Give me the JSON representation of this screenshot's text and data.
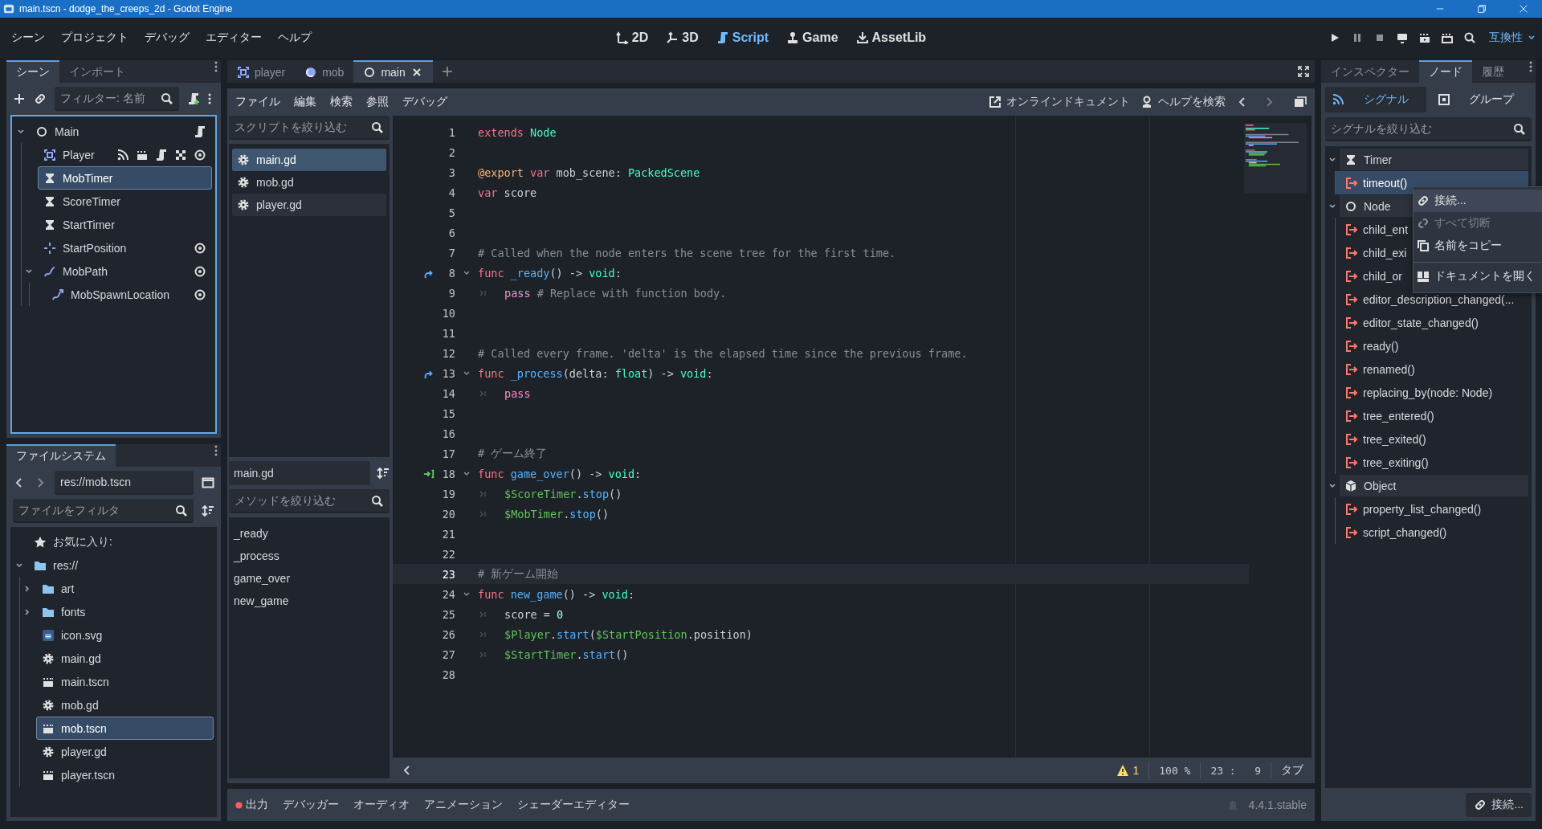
{
  "window": {
    "title": "main.tscn - dodge_the_creeps_2d - Godot Engine"
  },
  "menu": [
    "シーン",
    "プロジェクト",
    "デバッグ",
    "エディター",
    "ヘルプ"
  ],
  "workspaces": [
    {
      "label": "2D",
      "kind": "planar",
      "selected": false
    },
    {
      "label": "3D",
      "kind": "spatial",
      "selected": false
    },
    {
      "label": "Script",
      "kind": "script",
      "selected": true
    },
    {
      "label": "Game",
      "kind": "game",
      "selected": false
    },
    {
      "label": "AssetLib",
      "kind": "assetlib",
      "selected": false
    }
  ],
  "renderer": "互換性",
  "scene_dock": {
    "tabs": [
      {
        "label": "シーン",
        "selected": true
      },
      {
        "label": "インポート",
        "selected": false
      }
    ],
    "filter": {
      "placeholder": "フィルター: 名前"
    },
    "tree": [
      {
        "name": "Main",
        "kind": "node",
        "selected": false,
        "expanded": true,
        "badges": [
          {
            "kind": "script"
          }
        ],
        "children": [
          {
            "name": "Player",
            "kind": "node2d",
            "selected": false,
            "badges": [
              {
                "kind": "signal"
              },
              {
                "kind": "instance"
              },
              {
                "kind": "script"
              },
              {
                "kind": "editable"
              },
              {
                "kind": "eye"
              }
            ]
          },
          {
            "name": "MobTimer",
            "kind": "timer",
            "selected": true
          },
          {
            "name": "ScoreTimer",
            "kind": "timer",
            "selected": false
          },
          {
            "name": "StartTimer",
            "kind": "timer",
            "selected": false
          },
          {
            "name": "StartPosition",
            "kind": "marker",
            "selected": false,
            "badges": [
              {
                "kind": "eye"
              }
            ]
          },
          {
            "name": "MobPath",
            "kind": "path",
            "selected": false,
            "expanded": true,
            "badges": [
              {
                "kind": "eye"
              }
            ],
            "children": [
              {
                "name": "MobSpawnLocation",
                "kind": "pathfollow",
                "selected": false,
                "badges": [
                  {
                    "kind": "eye"
                  }
                ]
              }
            ]
          }
        ]
      }
    ]
  },
  "filesystem": {
    "tab": "ファイルシステム",
    "path": "res://mob.tscn",
    "filter": {
      "placeholder": "ファイルをフィルタ"
    },
    "favorites": "お気に入り:",
    "tree": [
      {
        "name": "res://",
        "kind": "folder",
        "selected": false,
        "expanded": true,
        "children": [
          {
            "name": "art",
            "kind": "folder",
            "selected": false,
            "expanded": false
          },
          {
            "name": "fonts",
            "kind": "folder",
            "selected": false,
            "expanded": false
          },
          {
            "name": "icon.svg",
            "kind": "image",
            "selected": false
          },
          {
            "name": "main.gd",
            "kind": "script",
            "selected": false
          },
          {
            "name": "main.tscn",
            "kind": "scene",
            "selected": false
          },
          {
            "name": "mob.gd",
            "kind": "script",
            "selected": false
          },
          {
            "name": "mob.tscn",
            "kind": "scene",
            "selected": true
          },
          {
            "name": "player.gd",
            "kind": "script",
            "selected": false
          },
          {
            "name": "player.tscn",
            "kind": "scene",
            "selected": false
          }
        ]
      }
    ]
  },
  "editor_tabs": [
    {
      "label": "player",
      "kind": "node2d",
      "selected": false
    },
    {
      "label": "mob",
      "kind": "rigid",
      "selected": false
    },
    {
      "label": "main",
      "kind": "node",
      "selected": true
    }
  ],
  "script_menu": [
    "ファイル",
    "編集",
    "検索",
    "参照",
    "デバッグ"
  ],
  "help_links": [
    {
      "label": "オンラインドキュメント",
      "kind": "external"
    },
    {
      "label": "ヘルプを検索",
      "kind": "help"
    }
  ],
  "scripts": {
    "filter": {
      "placeholder": "スクリプトを絞り込む"
    },
    "items": [
      {
        "name": "main.gd",
        "selected": true,
        "hovered": false
      },
      {
        "name": "mob.gd",
        "selected": false,
        "hovered": false
      },
      {
        "name": "player.gd",
        "selected": false,
        "hovered": true
      }
    ],
    "current": "main.gd",
    "method_filter": {
      "placeholder": "メソッドを絞り込む"
    },
    "methods": [
      "_ready",
      "_process",
      "game_over",
      "new_game"
    ]
  },
  "code": {
    "lines": [
      {
        "n": "1",
        "current": false,
        "foldable": false,
        "indented": false,
        "tokens": [
          {
            "kind": "keyword",
            "t": "extends "
          },
          {
            "kind": "type",
            "t": "Node"
          }
        ]
      },
      {
        "n": "2",
        "current": false,
        "foldable": false,
        "indented": false
      },
      {
        "n": "3",
        "current": false,
        "foldable": false,
        "indented": false,
        "tokens": [
          {
            "kind": "annotation",
            "t": "@export "
          },
          {
            "kind": "keyword",
            "t": "var"
          },
          {
            "kind": "plain",
            "t": " mob_scene: "
          },
          {
            "kind": "type",
            "t": "PackedScene"
          }
        ]
      },
      {
        "n": "4",
        "current": false,
        "foldable": false,
        "indented": false,
        "tokens": [
          {
            "kind": "keyword",
            "t": "var"
          },
          {
            "kind": "plain",
            "t": " score"
          }
        ]
      },
      {
        "n": "5",
        "current": false,
        "foldable": false,
        "indented": false
      },
      {
        "n": "6",
        "current": false,
        "foldable": false,
        "indented": false
      },
      {
        "n": "7",
        "current": false,
        "foldable": false,
        "indented": false,
        "tokens": [
          {
            "kind": "comment",
            "t": "# Called when the node enters the scene tree for the first time."
          }
        ]
      },
      {
        "n": "8",
        "current": false,
        "foldable": true,
        "indented": false,
        "gutter": {
          "kind": "override"
        },
        "tokens": [
          {
            "kind": "keyword",
            "t": "func "
          },
          {
            "kind": "function",
            "t": "_ready"
          },
          {
            "kind": "plain",
            "t": "() -> "
          },
          {
            "kind": "type",
            "t": "void"
          },
          {
            "kind": "plain",
            "t": ":"
          }
        ]
      },
      {
        "n": "9",
        "current": false,
        "foldable": false,
        "indented": true,
        "tokens": [
          {
            "kind": "control",
            "t": "pass"
          },
          {
            "kind": "comment",
            "t": " # Replace with function body."
          }
        ]
      },
      {
        "n": "10",
        "current": false,
        "foldable": false,
        "indented": false
      },
      {
        "n": "11",
        "current": false,
        "foldable": false,
        "indented": false
      },
      {
        "n": "12",
        "current": false,
        "foldable": false,
        "indented": false,
        "tokens": [
          {
            "kind": "comment",
            "t": "# Called every frame. 'delta' is the elapsed time since the previous frame."
          }
        ]
      },
      {
        "n": "13",
        "current": false,
        "foldable": true,
        "indented": false,
        "gutter": {
          "kind": "override"
        },
        "tokens": [
          {
            "kind": "keyword",
            "t": "func "
          },
          {
            "kind": "function",
            "t": "_process"
          },
          {
            "kind": "plain",
            "t": "(delta: "
          },
          {
            "kind": "type",
            "t": "float"
          },
          {
            "kind": "plain",
            "t": ") -> "
          },
          {
            "kind": "type",
            "t": "void"
          },
          {
            "kind": "plain",
            "t": ":"
          }
        ]
      },
      {
        "n": "14",
        "current": false,
        "foldable": false,
        "indented": true,
        "tokens": [
          {
            "kind": "control",
            "t": "pass"
          }
        ]
      },
      {
        "n": "15",
        "current": false,
        "foldable": false,
        "indented": false
      },
      {
        "n": "16",
        "current": false,
        "foldable": false,
        "indented": false
      },
      {
        "n": "17",
        "current": false,
        "foldable": false,
        "indented": false,
        "tokens": [
          {
            "kind": "comment",
            "t": "# ゲーム終了"
          }
        ]
      },
      {
        "n": "18",
        "current": false,
        "foldable": true,
        "indented": false,
        "gutter": {
          "kind": "connected"
        },
        "tokens": [
          {
            "kind": "keyword",
            "t": "func "
          },
          {
            "kind": "function",
            "t": "game_over"
          },
          {
            "kind": "plain",
            "t": "() -> "
          },
          {
            "kind": "type",
            "t": "void"
          },
          {
            "kind": "plain",
            "t": ":"
          }
        ]
      },
      {
        "n": "19",
        "current": false,
        "foldable": false,
        "indented": true,
        "tokens": [
          {
            "kind": "nodepath",
            "t": "$ScoreTimer"
          },
          {
            "kind": "plain",
            "t": "."
          },
          {
            "kind": "function",
            "t": "stop"
          },
          {
            "kind": "plain",
            "t": "()"
          }
        ]
      },
      {
        "n": "20",
        "current": false,
        "foldable": false,
        "indented": true,
        "tokens": [
          {
            "kind": "nodepath",
            "t": "$MobTimer"
          },
          {
            "kind": "plain",
            "t": "."
          },
          {
            "kind": "function",
            "t": "stop"
          },
          {
            "kind": "plain",
            "t": "()"
          }
        ]
      },
      {
        "n": "21",
        "current": false,
        "foldable": false,
        "indented": false
      },
      {
        "n": "22",
        "current": false,
        "foldable": false,
        "indented": false
      },
      {
        "n": "23",
        "current": true,
        "foldable": false,
        "indented": false,
        "tokens": [
          {
            "kind": "comment",
            "t": "# 新ゲーム開始"
          }
        ]
      },
      {
        "n": "24",
        "current": false,
        "foldable": true,
        "indented": false,
        "tokens": [
          {
            "kind": "keyword",
            "t": "func "
          },
          {
            "kind": "function",
            "t": "new_game"
          },
          {
            "kind": "plain",
            "t": "() -> "
          },
          {
            "kind": "type",
            "t": "void"
          },
          {
            "kind": "plain",
            "t": ":"
          }
        ]
      },
      {
        "n": "25",
        "current": false,
        "foldable": false,
        "indented": true,
        "tokens": [
          {
            "kind": "plain",
            "t": "score = "
          },
          {
            "kind": "number",
            "t": "0"
          }
        ]
      },
      {
        "n": "26",
        "current": false,
        "foldable": false,
        "indented": true,
        "tokens": [
          {
            "kind": "nodepath",
            "t": "$Player"
          },
          {
            "kind": "plain",
            "t": "."
          },
          {
            "kind": "function",
            "t": "start"
          },
          {
            "kind": "plain",
            "t": "("
          },
          {
            "kind": "nodepath",
            "t": "$StartPosition"
          },
          {
            "kind": "plain",
            "t": ".position)"
          }
        ]
      },
      {
        "n": "27",
        "current": false,
        "foldable": false,
        "indented": true,
        "tokens": [
          {
            "kind": "nodepath",
            "t": "$StartTimer"
          },
          {
            "kind": "plain",
            "t": "."
          },
          {
            "kind": "function",
            "t": "start"
          },
          {
            "kind": "plain",
            "t": "()"
          }
        ]
      },
      {
        "n": "28",
        "current": false,
        "foldable": false,
        "indented": false
      }
    ]
  },
  "status": {
    "warnings": "1",
    "zoom": "100 %",
    "cursor": "23 :   9",
    "indent": "タブ"
  },
  "bottom_tabs": [
    {
      "label": "出力",
      "alert": true
    },
    {
      "label": "デバッガー",
      "alert": false
    },
    {
      "label": "オーディオ",
      "alert": false
    },
    {
      "label": "アニメーション",
      "alert": false
    },
    {
      "label": "シェーダーエディター",
      "alert": false
    }
  ],
  "version": "4.4.1.stable",
  "node_dock": {
    "tabs": [
      {
        "label": "インスペクター",
        "selected": false
      },
      {
        "label": "ノード",
        "selected": true
      },
      {
        "label": "履歴",
        "selected": false
      }
    ],
    "subtabs": [
      {
        "label": "シグナル",
        "kind": "signals",
        "selected": true
      },
      {
        "label": "グループ",
        "kind": "groups",
        "selected": false
      }
    ],
    "filter": {
      "placeholder": "シグナルを絞り込む"
    },
    "groups": [
      {
        "name": "Timer",
        "kind": "timer",
        "signals": [
          {
            "name": "timeout()",
            "selected": true
          }
        ]
      },
      {
        "name": "Node",
        "kind": "node",
        "signals": [
          {
            "name": "child_ent",
            "selected": false
          },
          {
            "name": "child_exi",
            "selected": false
          },
          {
            "name": "child_or",
            "selected": false
          },
          {
            "name": "editor_description_changed(...",
            "selected": false
          },
          {
            "name": "editor_state_changed()",
            "selected": false
          },
          {
            "name": "ready()",
            "selected": false
          },
          {
            "name": "renamed()",
            "selected": false
          },
          {
            "name": "replacing_by(node: Node)",
            "selected": false
          },
          {
            "name": "tree_entered()",
            "selected": false
          },
          {
            "name": "tree_exited()",
            "selected": false
          },
          {
            "name": "tree_exiting()",
            "selected": false
          }
        ]
      },
      {
        "name": "Object",
        "kind": "object",
        "signals": [
          {
            "name": "property_list_changed()",
            "selected": false
          },
          {
            "name": "script_changed()",
            "selected": false
          }
        ]
      }
    ],
    "connect_button": "接続..."
  },
  "context_menu": [
    {
      "label": "接続...",
      "kind": "link",
      "highlighted": true,
      "disabled": false,
      "separator": false
    },
    {
      "label": "すべて切断",
      "kind": "unlink",
      "highlighted": false,
      "disabled": true,
      "separator": false
    },
    {
      "label": "名前をコピー",
      "kind": "copy",
      "highlighted": false,
      "disabled": false,
      "separator": false
    },
    {
      "label": "ドキュメントを開く",
      "kind": "doc",
      "highlighted": false,
      "disabled": false,
      "separator": true
    }
  ]
}
